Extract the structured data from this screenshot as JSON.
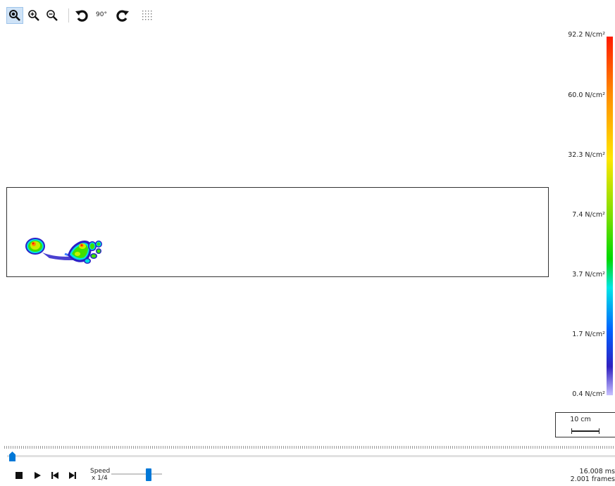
{
  "toolbar": {
    "rotate_label": "90°",
    "tools": [
      "select-zoom-icon",
      "zoom-in-icon",
      "zoom-out-icon",
      "rotate-ccw-icon",
      "rotate-cw-icon",
      "grid-icon"
    ]
  },
  "colorbar": {
    "labels": [
      "92.2 N/cm²",
      "60.0 N/cm²",
      "32.3 N/cm²",
      "7.4 N/cm²",
      "3.7 N/cm²",
      "1.7 N/cm²",
      "0.4 N/cm²"
    ],
    "colors": [
      "#ff1a00",
      "#ff8c00",
      "#ffe600",
      "#00d900",
      "#00e6e6",
      "#0060ff",
      "#c8c0ff"
    ]
  },
  "scale": {
    "label": "10 cm"
  },
  "playback": {
    "speed_label": "Speed",
    "speed_value": "x 1/4",
    "timeline_position": 0.0,
    "speed_level": 0.67
  },
  "readout": {
    "time": "16.008 ms",
    "frames": "2.001 frames"
  }
}
